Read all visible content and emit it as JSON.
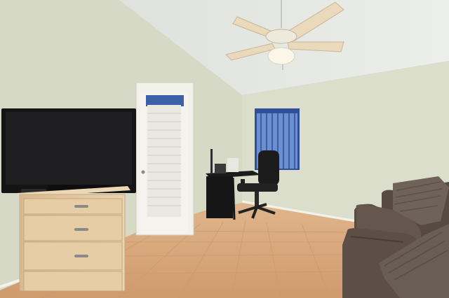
{
  "scene": {
    "kind": "room-photo",
    "objects": [
      "vaulted-ceiling",
      "ceiling-fan",
      "flat-screen-tv",
      "light-wood-dresser",
      "glass-door-with-blinds",
      "window-with-vertical-blinds",
      "black-desk",
      "office-chair",
      "brown-sofa",
      "throw-pillows",
      "tile-floor"
    ]
  },
  "palette": {
    "ceiling": "#e7e8e4",
    "left_wall": "#d9dcc9",
    "right_wall": "#dcdfcc",
    "floor": "#d8a97c",
    "dresser": "#e3c9a1",
    "sofa": "#5f5047",
    "blinds": "#4a6fb5"
  }
}
